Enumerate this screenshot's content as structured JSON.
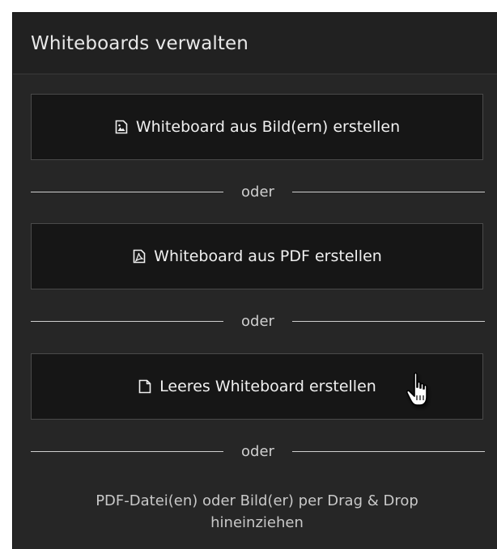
{
  "header": {
    "title": "Whiteboards verwalten"
  },
  "buttons": {
    "from_image": {
      "label": "Whiteboard aus Bild(ern) erstellen",
      "icon": "image-file-icon"
    },
    "from_pdf": {
      "label": "Whiteboard aus PDF erstellen",
      "icon": "pdf-file-icon"
    },
    "empty": {
      "label": "Leeres Whiteboard erstellen",
      "icon": "blank-file-icon"
    }
  },
  "dividers": {
    "or_label": "oder"
  },
  "dropzone": {
    "line1": "PDF-Datei(en) oder Bild(er) per Drag & Drop",
    "line2": "hineinziehen"
  },
  "colors": {
    "panel_bg": "#262626",
    "button_bg": "#161616",
    "button_border": "#4a4a4a",
    "text": "#f0f0f0"
  }
}
